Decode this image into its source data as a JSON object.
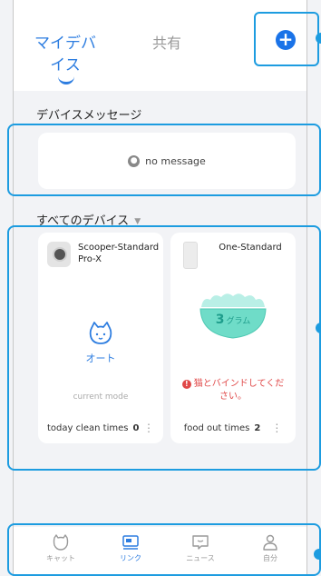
{
  "header": {
    "tab_mine": "マイデバイス",
    "tab_shared": "共有",
    "add_icon": "plus-circle-icon"
  },
  "messages": {
    "section_title": "デバイスメッセージ",
    "empty_text": "no message"
  },
  "devices": {
    "section_title": "すべてのデバイス",
    "items": [
      {
        "name": "Scooper-Standard Pro-X",
        "mode_label": "オート",
        "mode_caption": "current mode",
        "stat_label": "today clean times",
        "stat_value": "0"
      },
      {
        "name": "One-Standard",
        "amount_value": "3",
        "amount_unit": "グラム",
        "warning": "猫とバインドしてください。",
        "stat_label": "food out times",
        "stat_value": "2"
      }
    ]
  },
  "nav": {
    "items": [
      {
        "label": "キャット",
        "icon": "cat-face-icon"
      },
      {
        "label": "リンク",
        "icon": "device-link-icon"
      },
      {
        "label": "ニュース",
        "icon": "message-icon"
      },
      {
        "label": "自分",
        "icon": "user-icon"
      }
    ],
    "active": "リンク"
  },
  "colors": {
    "accent": "#2d7de0",
    "highlight": "#1d9ce0",
    "warning": "#e04848",
    "teal": "#1e9d8c"
  }
}
